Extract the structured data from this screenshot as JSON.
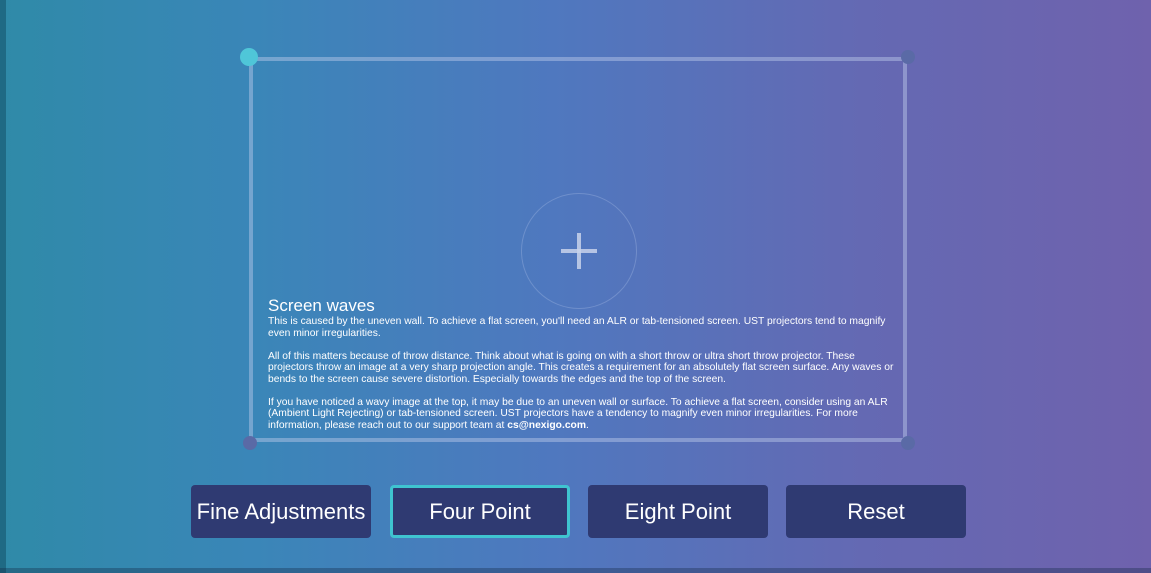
{
  "info": {
    "title": "Screen waves",
    "para1": "This is caused by the uneven wall. To achieve a flat screen, you'll need an ALR or tab-tensioned screen. UST projectors tend to magnify even minor irregularities.",
    "para2": "All of this matters because of throw distance. Think about what is going on with a short throw or ultra short throw projector. These projectors throw an image at a very sharp projection angle. This creates a requirement for an absolutely flat screen surface. Any waves or bends to the screen cause severe distortion. Especially towards the edges and the top of the screen.",
    "para3": "If you have noticed a wavy image at the top, it may be due to an uneven wall or surface. To achieve a flat screen, consider using an ALR (Ambient Light Rejecting) or tab-tensioned screen. UST projectors have a tendency to magnify even minor irregularities. For more information, please reach out to our support team at",
    "email": "cs@nexigo.com",
    "period": "."
  },
  "buttons": {
    "fine": "Fine Adjustments",
    "four": "Four Point",
    "eight": "Eight Point",
    "reset": "Reset"
  },
  "selected_mode": "Four Point",
  "colors": {
    "active_corner": "#4fc6d8",
    "button_bg": "#2f3a72",
    "selected_border": "#3fc4d0"
  },
  "icons": {
    "center": "plus-icon"
  }
}
